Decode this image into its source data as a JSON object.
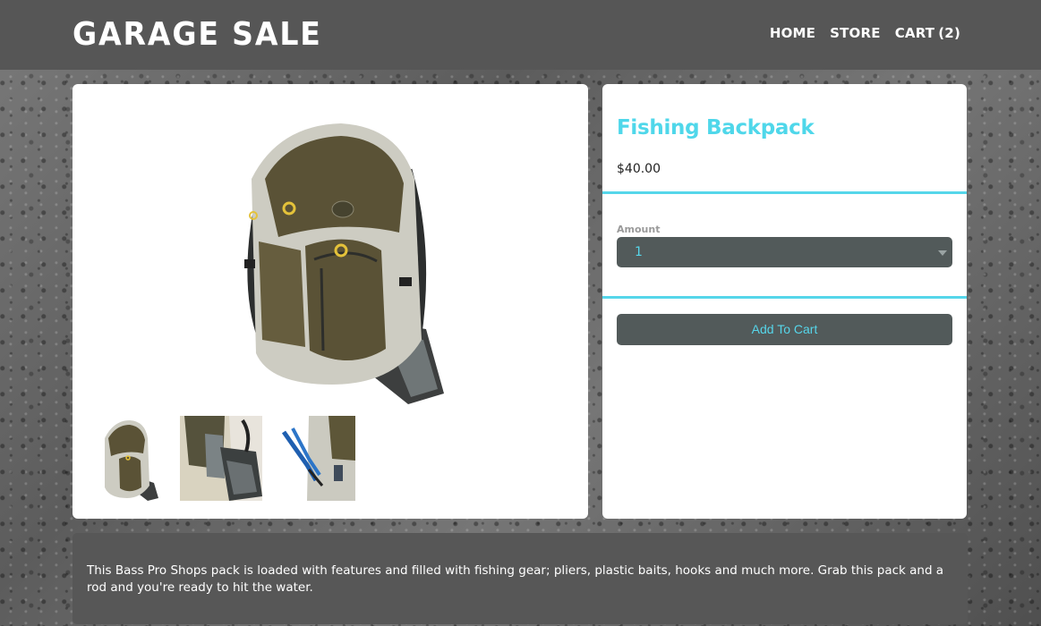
{
  "header": {
    "brand": "GARAGE SALE",
    "nav": [
      {
        "label": "HOME"
      },
      {
        "label": "STORE"
      },
      {
        "label": "CART"
      }
    ],
    "cart_count": "(2)"
  },
  "product": {
    "title": "Fishing Backpack",
    "price": "$40.00",
    "amount_label": "Amount",
    "amount_value": "1",
    "add_to_cart_label": "Add To Cart",
    "description": "This Bass Pro Shops pack is loaded with features and filled with fishing gear; pliers, plastic baits, hooks and much more. Grab this pack and a rod and you're ready to hit the water."
  },
  "colors": {
    "accent": "#56d6ea",
    "header_bg": "#565656",
    "control_bg": "#525a5a",
    "pack_olive": "#5a5236",
    "pack_grey": "#c9c7bd"
  },
  "icons": {
    "select_caret": "caret-down-icon"
  }
}
